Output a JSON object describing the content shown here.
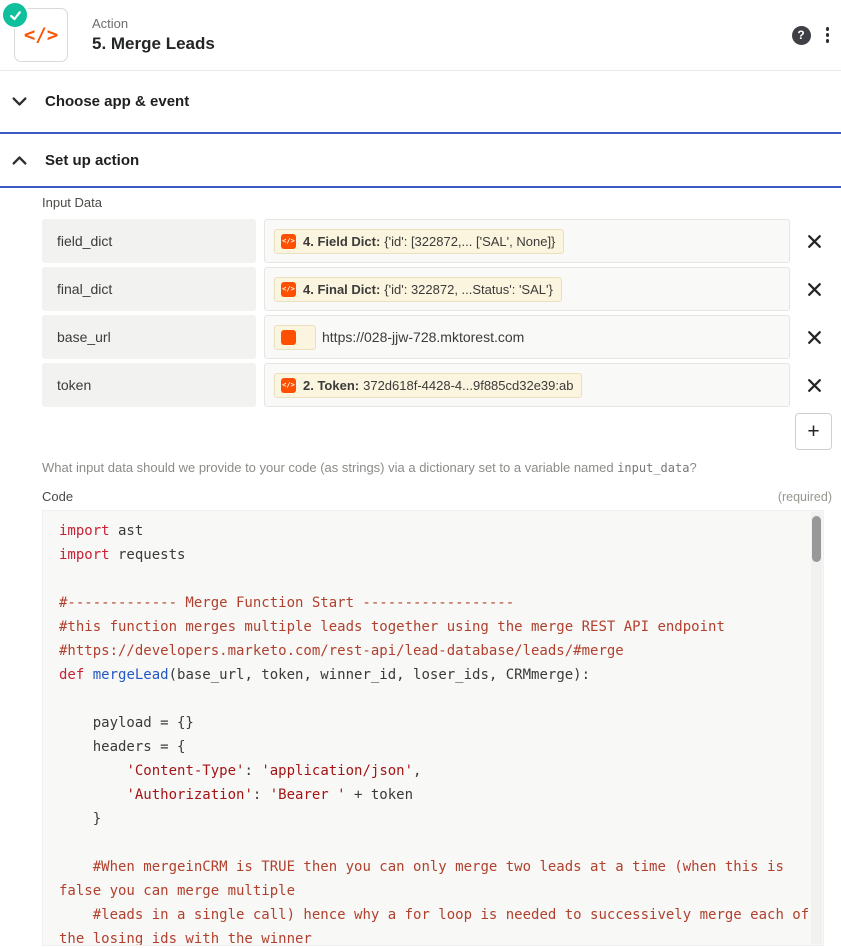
{
  "header": {
    "kicker": "Action",
    "title": "5. Merge Leads"
  },
  "icons": {
    "code_glyph": "</>",
    "help": "?",
    "add": "+"
  },
  "colors": {
    "accent_blue": "#3a5bc4",
    "brand_orange": "#ff4f00",
    "success_green": "#10bf9b",
    "pill_bg": "#fbf4df"
  },
  "sections": [
    {
      "label": "Choose app & event",
      "state": "collapsed"
    },
    {
      "label": "Set up action",
      "state": "expanded"
    }
  ],
  "input_data": {
    "label": "Input Data",
    "rows": [
      {
        "key": "field_dict",
        "type": "pill",
        "pill_prefix": "4. Field Dict:",
        "pill_value": "{'id': [322872,... ['SAL', None]}"
      },
      {
        "key": "final_dict",
        "type": "pill",
        "pill_prefix": "4. Final Dict:",
        "pill_value": "{'id': 322872, ...Status': 'SAL'}"
      },
      {
        "key": "base_url",
        "type": "text",
        "value": "https://028-jjw-728.mktorest.com"
      },
      {
        "key": "token",
        "type": "pill",
        "pill_prefix": "2. Token:",
        "pill_value": "372d618f-4428-4...9f885cd32e39:ab"
      }
    ],
    "help_before": "What input data should we provide to your code (as strings) via a dictionary set to a variable named ",
    "help_code": "input_data",
    "help_after": "?"
  },
  "code_section": {
    "label": "Code",
    "required": "(required)",
    "lines": [
      [
        {
          "t": "import",
          "c": "kw"
        },
        {
          "t": " ast",
          "c": "pl"
        }
      ],
      [
        {
          "t": "import",
          "c": "kw"
        },
        {
          "t": " requests",
          "c": "pl"
        }
      ],
      [],
      [
        {
          "t": "#------------- Merge Function Start ------------------",
          "c": "cm"
        }
      ],
      [
        {
          "t": "#this function merges multiple leads together using the merge REST API endpoint",
          "c": "cm"
        }
      ],
      [
        {
          "t": "#https://developers.marketo.com/rest-api/lead-database/leads/#merge",
          "c": "cm"
        }
      ],
      [
        {
          "t": "def",
          "c": "kw"
        },
        {
          "t": " ",
          "c": "pl"
        },
        {
          "t": "mergeLead",
          "c": "df"
        },
        {
          "t": "(base_url, token, winner_id, loser_ids, CRMmerge):",
          "c": "pl"
        }
      ],
      [],
      [
        {
          "t": "    payload = {}",
          "c": "pl"
        }
      ],
      [
        {
          "t": "    headers = {",
          "c": "pl"
        }
      ],
      [
        {
          "t": "        ",
          "c": "pl"
        },
        {
          "t": "'Content-Type'",
          "c": "st"
        },
        {
          "t": ": ",
          "c": "pl"
        },
        {
          "t": "'application/json'",
          "c": "st"
        },
        {
          "t": ",",
          "c": "pl"
        }
      ],
      [
        {
          "t": "        ",
          "c": "pl"
        },
        {
          "t": "'Authorization'",
          "c": "st"
        },
        {
          "t": ": ",
          "c": "pl"
        },
        {
          "t": "'Bearer '",
          "c": "st"
        },
        {
          "t": " + token",
          "c": "pl"
        }
      ],
      [
        {
          "t": "    }",
          "c": "pl"
        }
      ],
      [],
      [
        {
          "t": "    #When mergeinCRM is TRUE then you can only merge two leads at a time (when this is false you can merge multiple",
          "c": "cm"
        }
      ],
      [
        {
          "t": "    #leads in a single call) hence why a for loop is needed to successively merge each of the losing ids with the winner",
          "c": "cm"
        }
      ]
    ]
  }
}
